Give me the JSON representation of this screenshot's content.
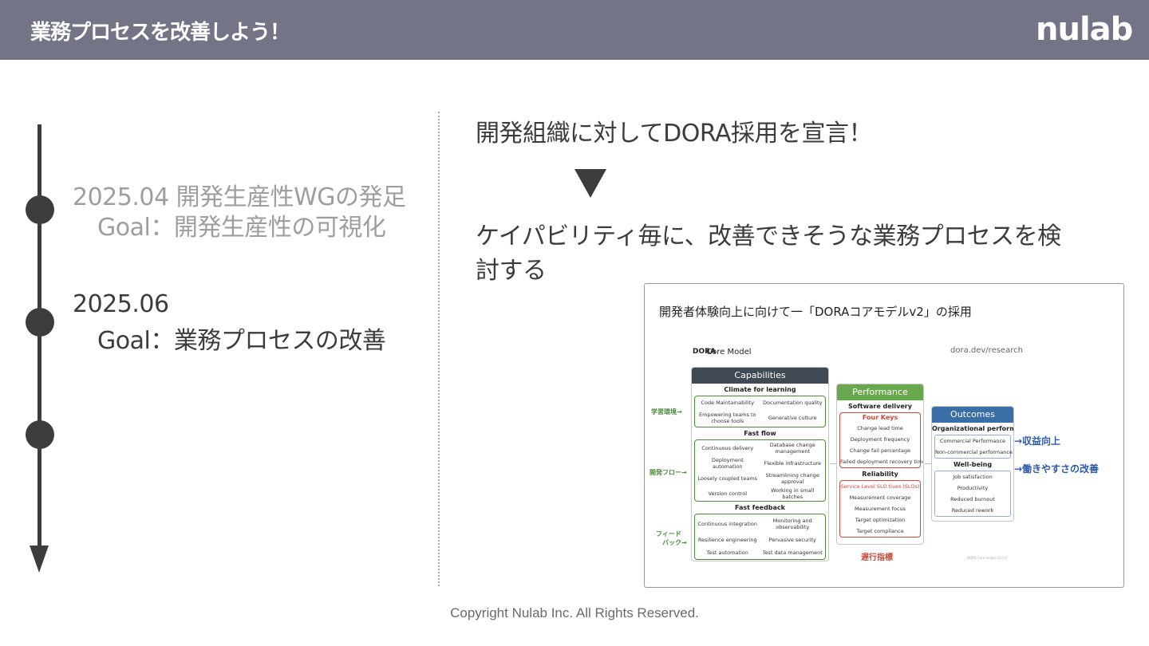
{
  "header": {
    "title": "業務プロセスを改善しよう！",
    "logo": "nulab"
  },
  "timeline": {
    "items": [
      {
        "date": "2025.04 開発生産性WGの発足",
        "goal": "Goal：開発生産性の可視化",
        "state": "past"
      },
      {
        "date": "2025.06",
        "goal": "Goal：業務プロセスの改善",
        "state": "current"
      }
    ]
  },
  "right": {
    "headline": "開発組織に対してDORA採用を宣言！",
    "body": "ケイパビリティ毎に、改善できそうな業務プロセスを検討する"
  },
  "image": {
    "title": "開発者体験向上に向けて一「DORAコアモデルv2」の採用",
    "logo_text": "Core Model",
    "logo_mark": "DORA",
    "url": "dora.dev/research",
    "capabilities": {
      "header": "Capabilities",
      "sections": [
        {
          "title": "Climate for learning",
          "cells": [
            "Code Maintainability",
            "Documentation quality",
            "Empowering teams to choose tools",
            "Generative culture"
          ]
        },
        {
          "title": "Fast flow",
          "cells": [
            "Continuous delivery",
            "Database change management",
            "Deployment automation",
            "Flexible infrastructure",
            "Loosely coupled teams",
            "Streamlining change approval",
            "Version control",
            "Working in small batches"
          ]
        },
        {
          "title": "Fast feedback",
          "cells": [
            "Continuous integration",
            "Monitoring and observability",
            "Resilience engineering",
            "Pervasive security",
            "Test automation",
            "Test data management"
          ]
        }
      ]
    },
    "performance": {
      "header": "Performance",
      "software_delivery": "Software delivery",
      "four_keys": "Four Keys",
      "delivery_items": [
        "Change lead time",
        "Deployment frequency",
        "Change fail percentage",
        "Failed deployment recovery time"
      ],
      "reliability": "Reliability",
      "slo_line": "Service Level SLO tives (SLOs)",
      "reliability_items": [
        "Measurement coverage",
        "Measurement focus",
        "Target optimization",
        "Target compliance"
      ]
    },
    "outcomes": {
      "header": "Outcomes",
      "org": "Organizational performance",
      "org_items": [
        "Commercial Performance",
        "Non-commercial performance"
      ],
      "wellbeing": "Well-being",
      "wellbeing_items": [
        "Job satisfaction",
        "Productivity",
        "Reduced burnout",
        "Reduced rework"
      ]
    },
    "side_labels": {
      "learning": "学習環境→",
      "flow": "開発フロー→",
      "feedback_1": "フィード",
      "feedback_2": "バック→"
    },
    "outcome_labels": {
      "revenue": "→収益向上",
      "workability": "→働きやすさの改善"
    },
    "lead_label": "遅行指標",
    "footnote": "DORA Core model v2.0.0"
  },
  "footer": "Copyright Nulab Inc. All Rights Reserved.",
  "colors": {
    "header_bg": "#737486",
    "capabilities_head": "#3f4a54",
    "performance_head": "#6aa84f",
    "outcomes_head": "#3a6ea5",
    "green_box": "#4a8a3a",
    "red_box": "#c84a3a",
    "blue_label": "#2e5aa8"
  }
}
